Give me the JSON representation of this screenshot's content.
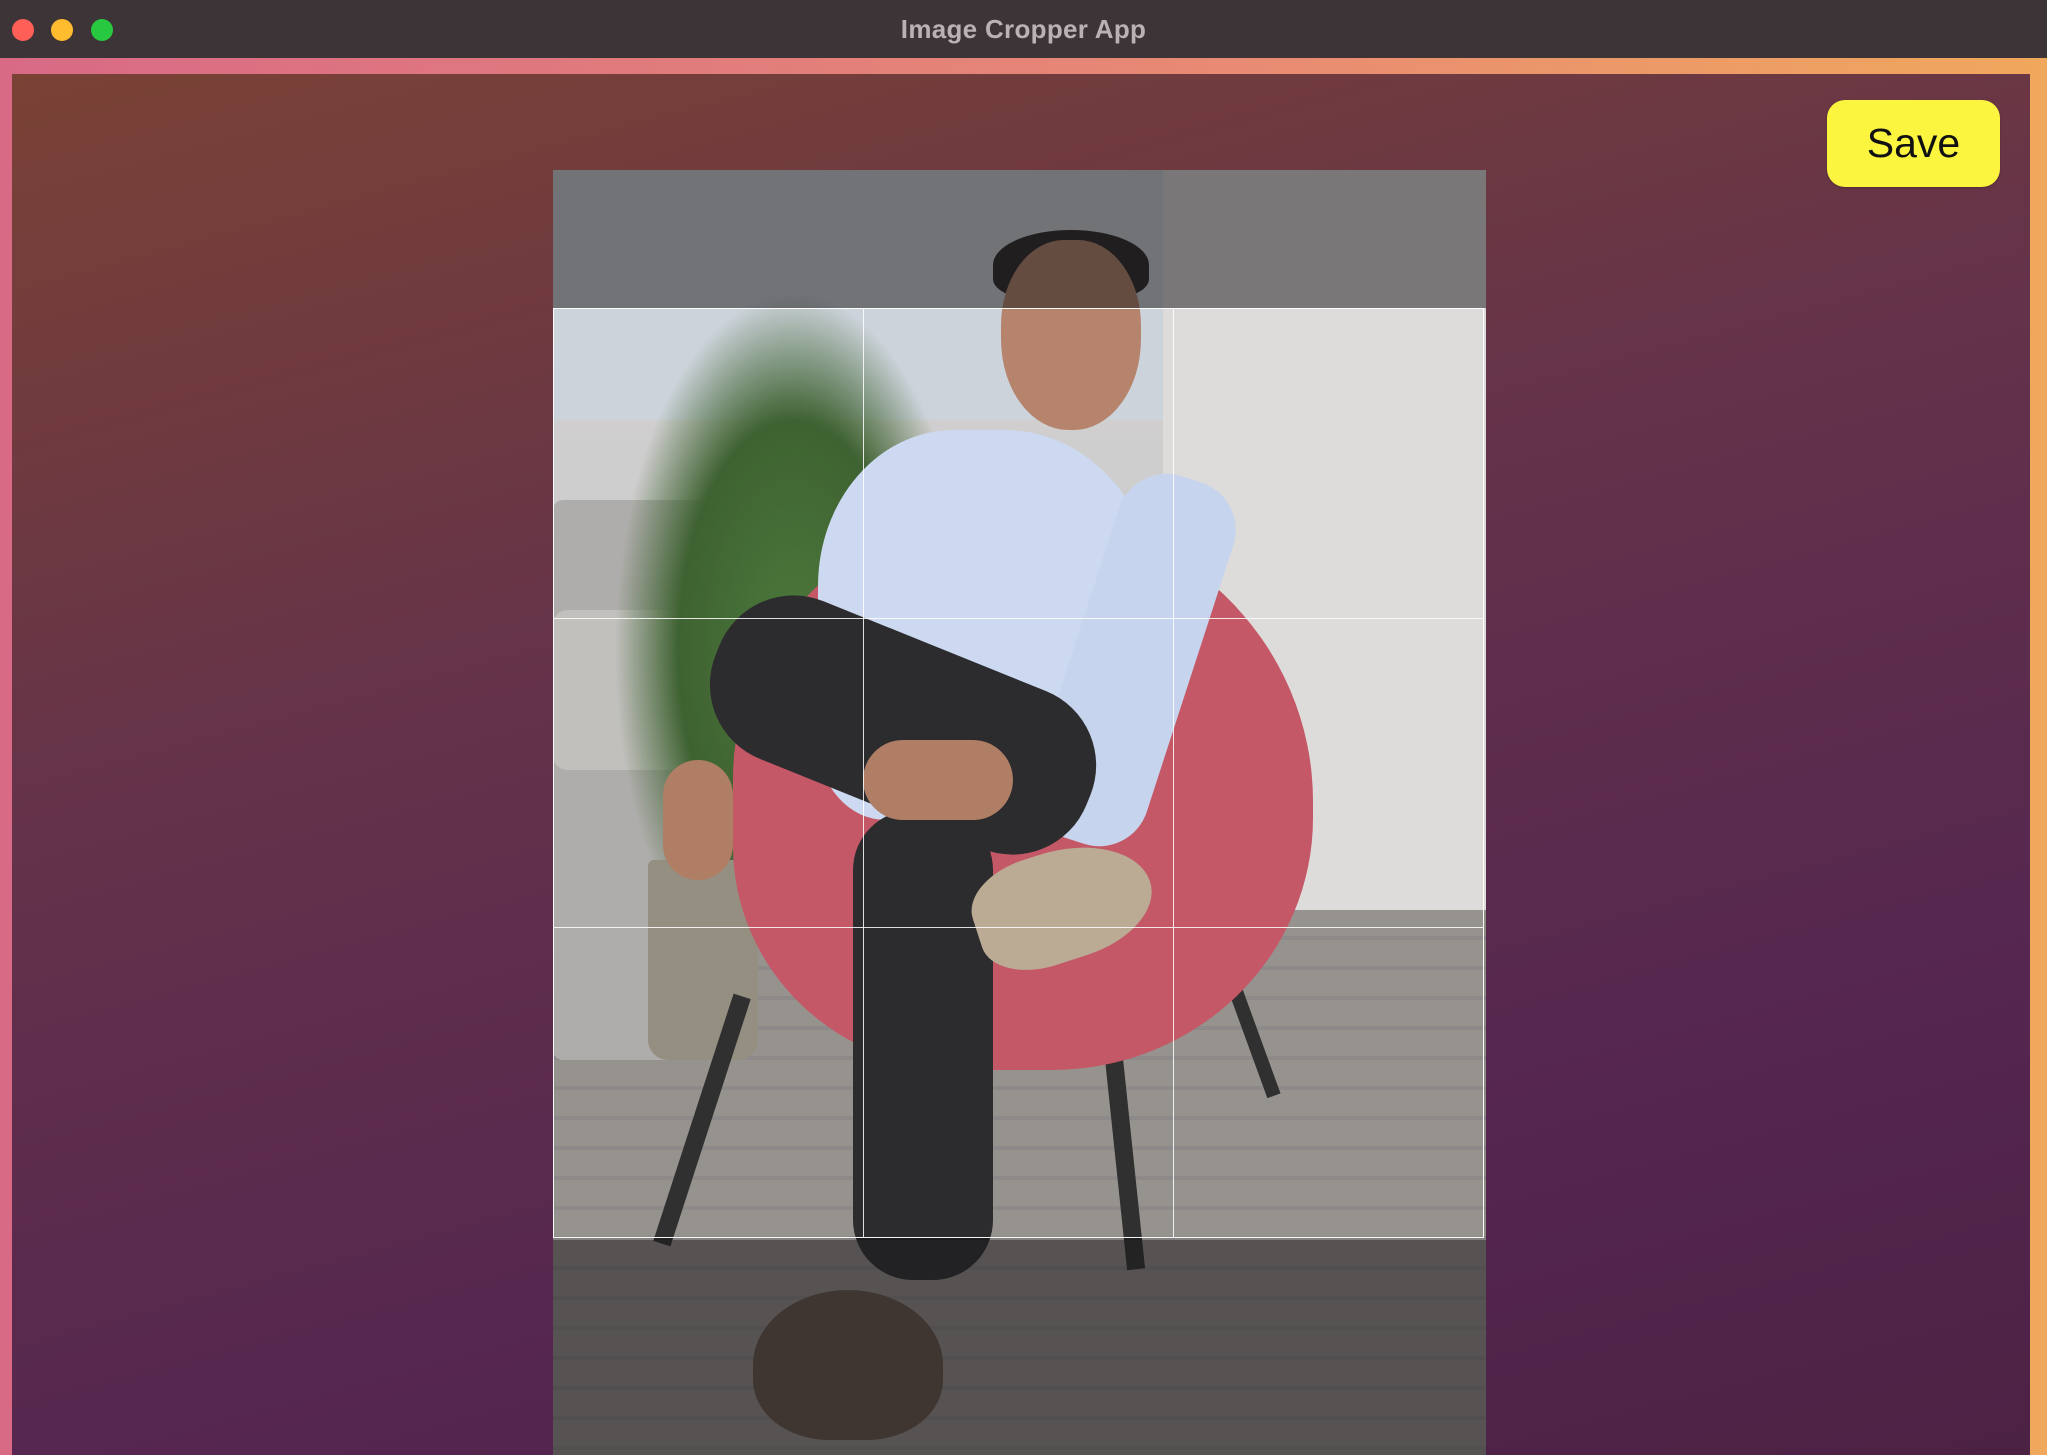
{
  "window": {
    "title": "Image Cropper App",
    "controls": [
      "close",
      "minimize",
      "maximize"
    ]
  },
  "toolbar": {
    "save_label": "Save"
  },
  "colors": {
    "save_button": "#fbf53f",
    "titlebar": "#3d3438"
  },
  "crop": {
    "grid": "rule-of-thirds"
  }
}
